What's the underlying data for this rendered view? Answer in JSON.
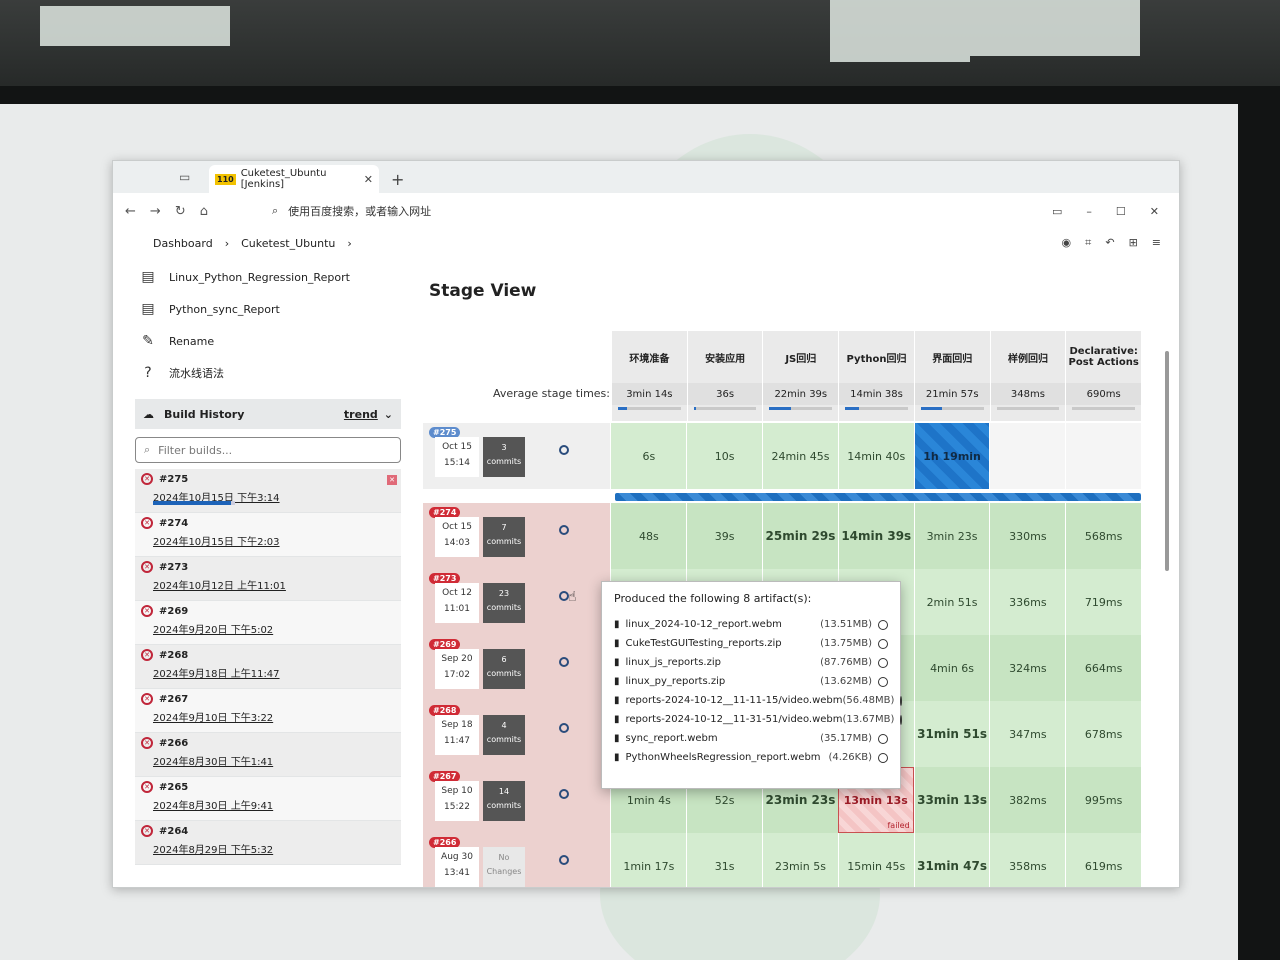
{
  "browser": {
    "tab_title": "Cuketest_Ubuntu [Jenkins]",
    "tab_favicon": "110",
    "address_placeholder": "使用百度搜索，或者输入网址"
  },
  "breadcrumb": [
    "Dashboard",
    "Cuketest_Ubuntu"
  ],
  "sidebar": {
    "links": [
      {
        "label": "Linux_Python_Regression_Report",
        "icon": "report-icon"
      },
      {
        "label": "Python_sync_Report",
        "icon": "report-icon"
      },
      {
        "label": "Rename",
        "icon": "pencil-icon"
      },
      {
        "label": "流水线语法",
        "icon": "help-icon"
      }
    ],
    "build_history_label": "Build History",
    "trend_label": "trend",
    "filter_placeholder": "Filter builds...",
    "builds": [
      {
        "id": "#275",
        "date": "2024年10月15日 下午3:14",
        "progress": 0.95,
        "running": true
      },
      {
        "id": "#274",
        "date": "2024年10月15日 下午2:03"
      },
      {
        "id": "#273",
        "date": "2024年10月12日 上午11:01"
      },
      {
        "id": "#269",
        "date": "2024年9月20日 下午5:02"
      },
      {
        "id": "#268",
        "date": "2024年9月18日 上午11:47"
      },
      {
        "id": "#267",
        "date": "2024年9月10日 下午3:22"
      },
      {
        "id": "#266",
        "date": "2024年8月30日 下午1:41"
      },
      {
        "id": "#265",
        "date": "2024年8月30日 上午9:41"
      },
      {
        "id": "#264",
        "date": "2024年8月29日 下午5:32"
      }
    ]
  },
  "stage_view": {
    "title": "Stage View",
    "avg_label": "Average stage times:",
    "stages": [
      {
        "name": "环境准备",
        "avg": "3min 14s",
        "fill": 0.15
      },
      {
        "name": "安装应用",
        "avg": "36s",
        "fill": 0.04
      },
      {
        "name": "JS回归",
        "avg": "22min 39s",
        "fill": 0.35
      },
      {
        "name": "Python回归",
        "avg": "14min 38s",
        "fill": 0.22
      },
      {
        "name": "界面回归",
        "avg": "21min 57s",
        "fill": 0.33
      },
      {
        "name": "样例回归",
        "avg": "348ms",
        "fill": 0.0
      },
      {
        "name": "Declarative: Post Actions",
        "avg": "690ms",
        "fill": 0.0
      }
    ],
    "runs": [
      {
        "id": "#275",
        "date": "Oct 15",
        "time": "15:14",
        "commits": "3",
        "commits_label": "commits",
        "status": "running",
        "cells": [
          "6s",
          "10s",
          "24min 45s",
          "14min 40s",
          "1h 19min",
          "",
          ""
        ]
      },
      {
        "id": "#274",
        "date": "Oct 15",
        "time": "14:03",
        "commits": "7",
        "commits_label": "commits",
        "status": "failed",
        "cells": [
          "48s",
          "39s",
          "25min 29s",
          "14min 39s",
          "3min 23s",
          "330ms",
          "568ms"
        ]
      },
      {
        "id": "#273",
        "date": "Oct 12",
        "time": "11:01",
        "commits": "23",
        "commits_label": "commits",
        "status": "failed",
        "cells": [
          "",
          "",
          "",
          "",
          "2min 51s",
          "336ms",
          "719ms"
        ]
      },
      {
        "id": "#269",
        "date": "Sep 20",
        "time": "17:02",
        "commits": "6",
        "commits_label": "commits",
        "status": "failed",
        "cells": [
          "",
          "",
          "",
          "",
          "4min 6s",
          "324ms",
          "664ms"
        ]
      },
      {
        "id": "#268",
        "date": "Sep 18",
        "time": "11:47",
        "commits": "4",
        "commits_label": "commits",
        "status": "failed",
        "cells": [
          "",
          "",
          "",
          "",
          "31min 51s",
          "347ms",
          "678ms"
        ]
      },
      {
        "id": "#267",
        "date": "Sep 10",
        "time": "15:22",
        "commits": "14",
        "commits_label": "commits",
        "status": "failed",
        "cells": [
          "1min 4s",
          "52s",
          "23min 23s",
          "13min 13s",
          "33min 13s",
          "382ms",
          "995ms"
        ],
        "failed_cell": 3,
        "failed_label": "failed"
      },
      {
        "id": "#266",
        "date": "Aug 30",
        "time": "13:41",
        "commits": "No",
        "commits_label": "Changes",
        "status": "failed",
        "nochange": true,
        "cells": [
          "1min 17s",
          "31s",
          "23min 5s",
          "15min 45s",
          "31min 47s",
          "358ms",
          "619ms"
        ]
      }
    ]
  },
  "artifacts_popup": {
    "title": "Produced the following 8 artifact(s):",
    "items": [
      {
        "name": "linux_2024-10-12_report.webm",
        "size": "(13.51MB)"
      },
      {
        "name": "CukeTestGUITesting_reports.zip",
        "size": "(13.75MB)"
      },
      {
        "name": "linux_js_reports.zip",
        "size": "(87.76MB)"
      },
      {
        "name": "linux_py_reports.zip",
        "size": "(13.62MB)"
      },
      {
        "name": "reports-2024-10-12__11-11-15/video.webm",
        "size": "(56.48MB)"
      },
      {
        "name": "reports-2024-10-12__11-31-51/video.webm",
        "size": "(13.67MB)"
      },
      {
        "name": "sync_report.webm",
        "size": "(35.17MB)"
      },
      {
        "name": "PythonWheelsRegression_report.webm",
        "size": "(4.26KB)"
      }
    ]
  }
}
